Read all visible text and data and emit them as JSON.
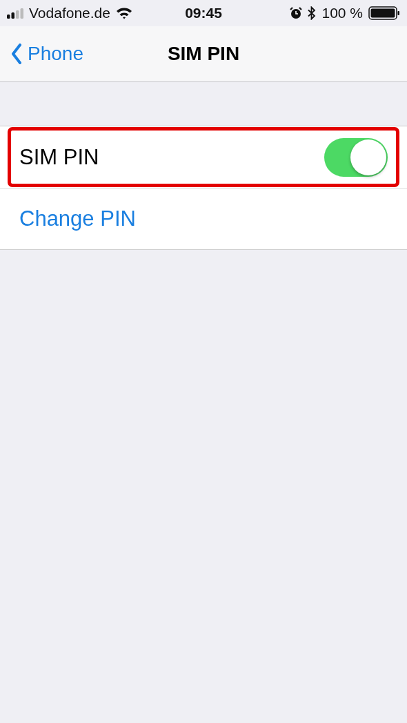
{
  "status_bar": {
    "carrier": "Vodafone.de",
    "time": "09:45",
    "battery": "100 %"
  },
  "nav_bar": {
    "back_label": "Phone",
    "title": "SIM PIN"
  },
  "rows": [
    {
      "kind": "toggle",
      "label": "SIM PIN",
      "on": true,
      "highlighted": true
    },
    {
      "kind": "link",
      "label": "Change PIN",
      "highlighted": false
    }
  ]
}
